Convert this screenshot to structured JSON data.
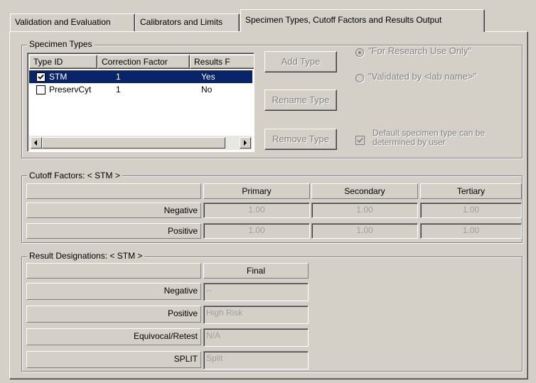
{
  "tabs": [
    {
      "label": "Validation and Evaluation"
    },
    {
      "label": "Calibrators and Limits"
    },
    {
      "label": "Specimen Types, Cutoff Factors and Results Output"
    }
  ],
  "specimen_types": {
    "group_label": "Specimen Types",
    "columns": [
      "Type ID",
      "Correction Factor",
      "Results F"
    ],
    "rows": [
      {
        "checked": true,
        "type_id": "STM",
        "correction_factor": "1",
        "results": "Yes",
        "selected": true
      },
      {
        "checked": false,
        "type_id": "PreservCyt",
        "correction_factor": "1",
        "results": "No",
        "selected": false
      }
    ],
    "buttons": {
      "add": "Add Type",
      "rename": "Rename Type",
      "remove": "Remove Type"
    },
    "radio_research": "\"For Research Use Only\"",
    "radio_validated": "\"Validated by <lab name>\"",
    "default_checkbox": "Default specimen type can be determined by user"
  },
  "cutoff_factors": {
    "group_label": "Cutoff Factors: < STM >",
    "columns": [
      "Primary",
      "Secondary",
      "Tertiary"
    ],
    "rows": [
      {
        "label": "Negative",
        "values": [
          "1.00",
          "1.00",
          "1.00"
        ]
      },
      {
        "label": "Positive",
        "values": [
          "1.00",
          "1.00",
          "1.00"
        ]
      }
    ]
  },
  "result_designations": {
    "group_label": "Result Designations: < STM >",
    "column": "Final",
    "rows": [
      {
        "label": "Negative",
        "value": "--"
      },
      {
        "label": "Positive",
        "value": "High Risk"
      },
      {
        "label": "Equivocal/Retest",
        "value": "N/A"
      },
      {
        "label": "SPLIT",
        "value": "Split"
      }
    ]
  }
}
